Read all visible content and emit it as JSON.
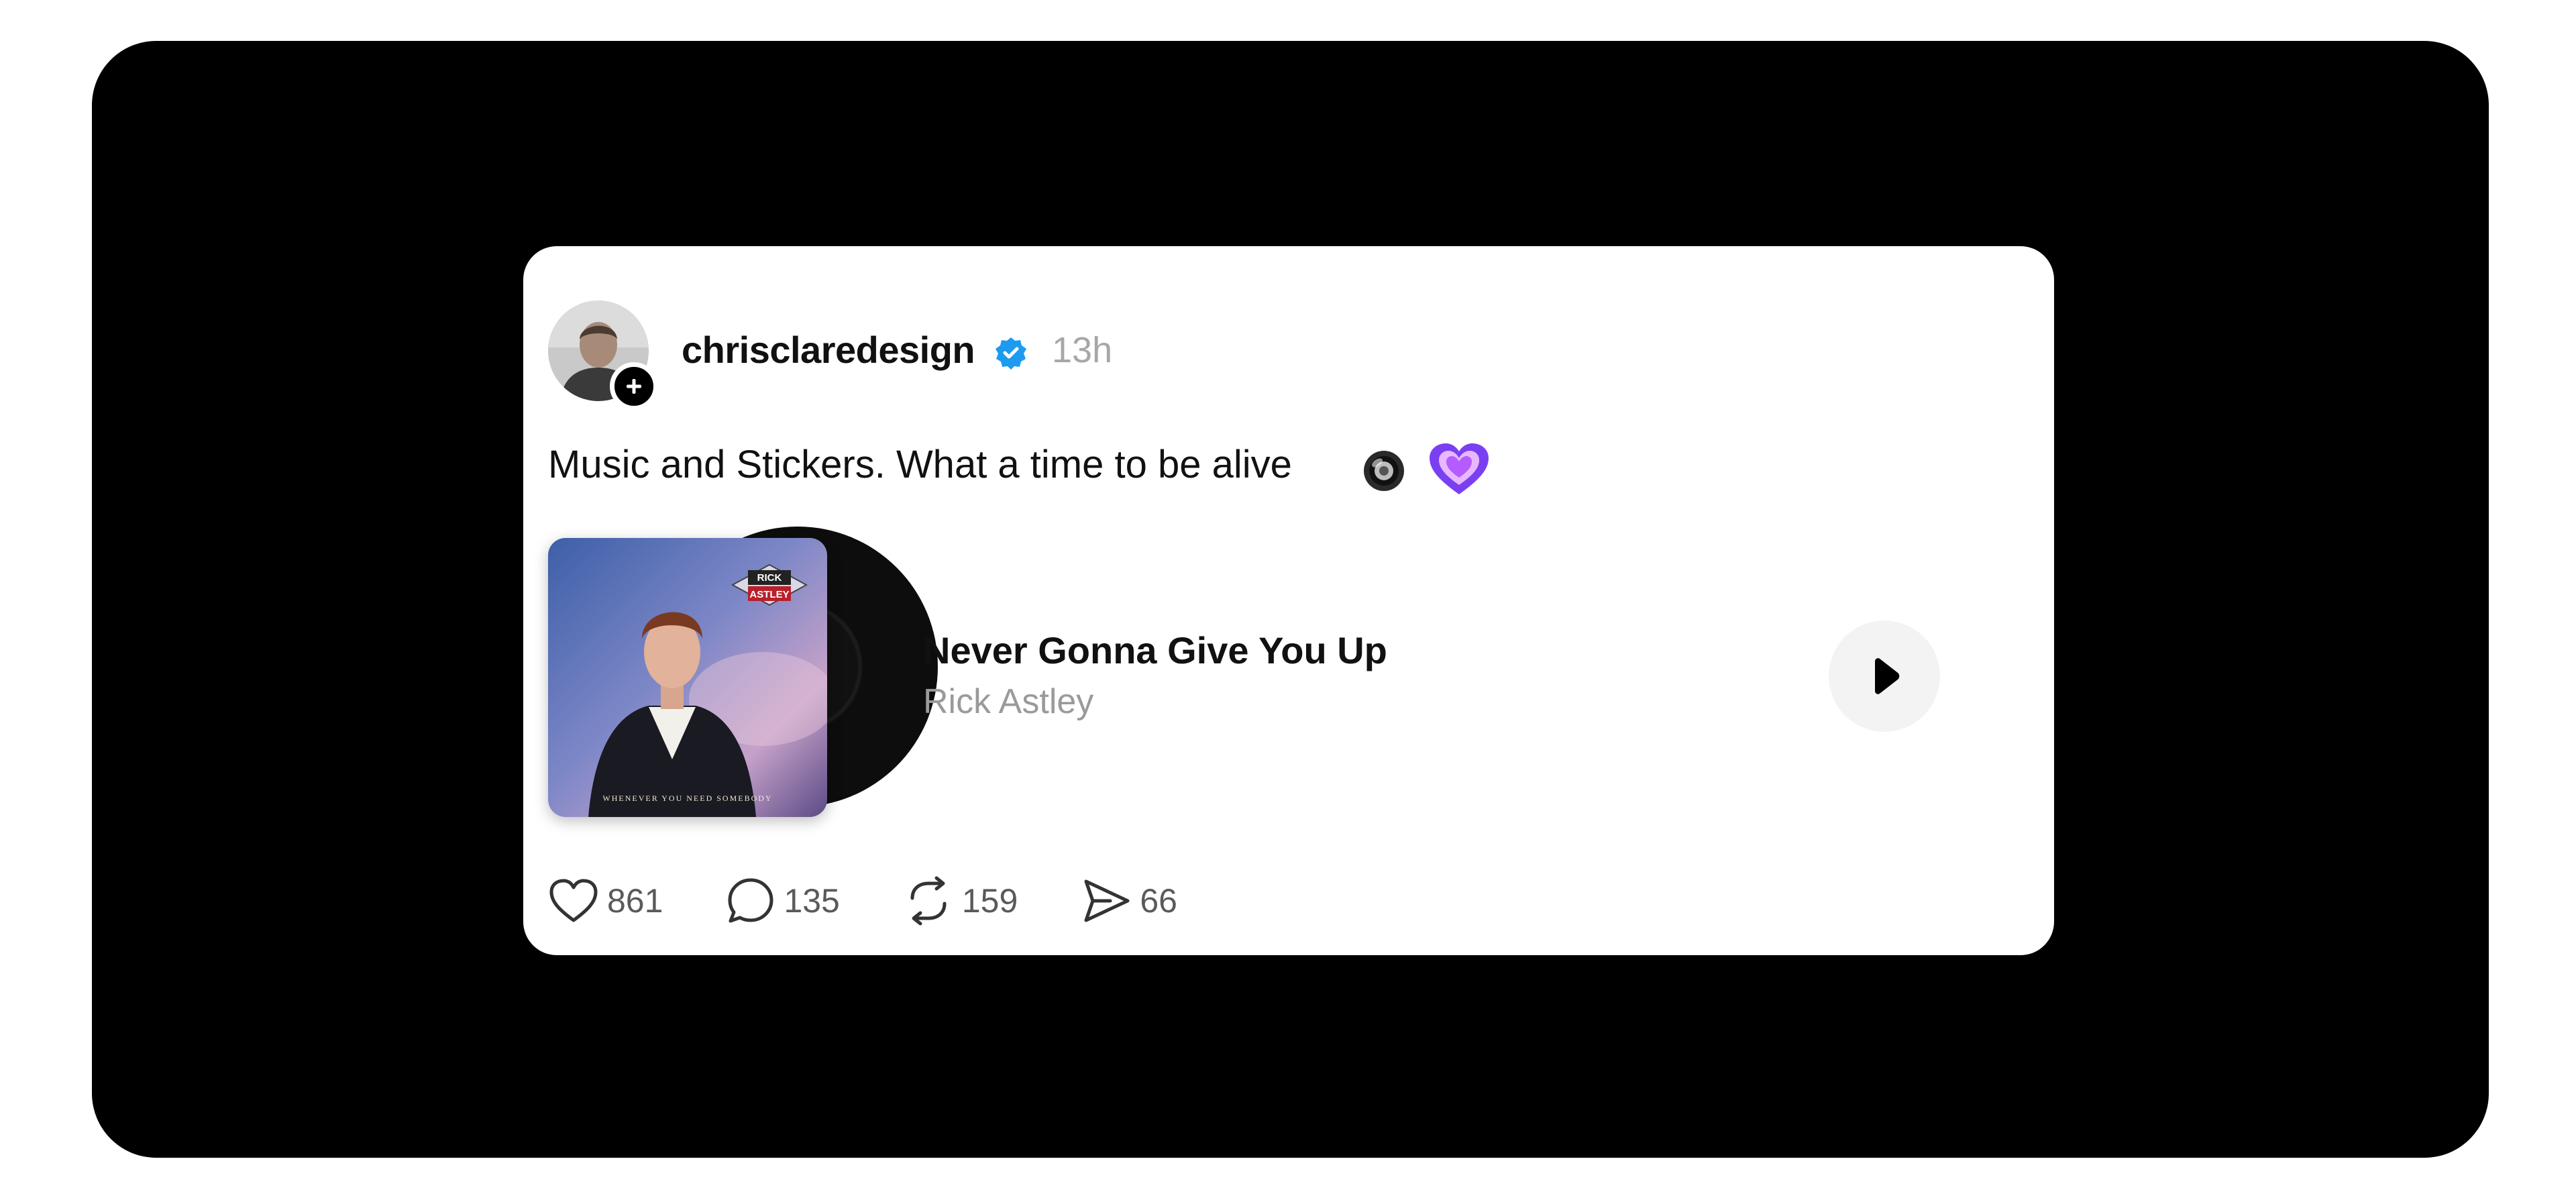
{
  "post": {
    "username": "chrisclaredesign",
    "timestamp": "13h",
    "verified": true,
    "caption": "Music and Stickers. What a time to be alive",
    "caption_emojis": [
      "speaker-emoji",
      "purple-heart-emoji"
    ]
  },
  "music": {
    "title": "Never Gonna Give You Up",
    "artist": "Rick Astley",
    "album_logo_text": [
      "RICK",
      "ASTLEY"
    ],
    "album_footer_text": "WHENEVER YOU NEED SOMEBODY"
  },
  "actions": {
    "likes": "861",
    "comments": "135",
    "reposts": "159",
    "shares": "66"
  },
  "colors": {
    "frame": "#000000",
    "card": "#ffffff",
    "verified": "#1d9bf0",
    "muted_text": "#a7a7a7"
  },
  "icons": {
    "like": "heart-icon",
    "comment": "comment-bubble-icon",
    "repost": "repost-icon",
    "share": "share-send-icon",
    "play": "play-icon",
    "verified": "verified-badge-icon",
    "follow": "plus-icon"
  }
}
